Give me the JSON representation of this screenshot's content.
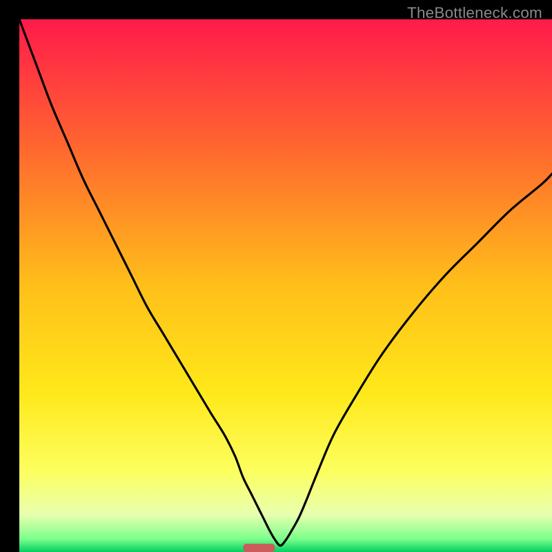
{
  "watermark": "TheBottleneck.com",
  "chart_data": {
    "type": "line",
    "title": "",
    "xlabel": "",
    "ylabel": "",
    "xlim": [
      0,
      100
    ],
    "ylim": [
      0,
      100
    ],
    "grid": false,
    "legend": false,
    "background_gradient_stops": [
      {
        "offset": 0.0,
        "color": "#ff1a4b"
      },
      {
        "offset": 0.25,
        "color": "#ff6a2e"
      },
      {
        "offset": 0.5,
        "color": "#ffbf1a"
      },
      {
        "offset": 0.7,
        "color": "#ffe81a"
      },
      {
        "offset": 0.85,
        "color": "#fcff60"
      },
      {
        "offset": 0.93,
        "color": "#e8ffb0"
      },
      {
        "offset": 0.975,
        "color": "#7dff8c"
      },
      {
        "offset": 1.0,
        "color": "#00d060"
      }
    ],
    "series": [
      {
        "name": "curve",
        "x": [
          0,
          3,
          6,
          9,
          12,
          15,
          18,
          21,
          24,
          27,
          30,
          33,
          36,
          38.5,
          40.5,
          42,
          43.5,
          45,
          46,
          47,
          48,
          49,
          50,
          51,
          52.5,
          54,
          56,
          59,
          63,
          68,
          74,
          80,
          86,
          92,
          98,
          100
        ],
        "y": [
          100,
          92,
          84,
          77,
          70,
          64,
          58,
          52,
          46,
          41,
          36,
          31,
          26,
          22,
          18,
          14,
          11,
          8,
          6,
          4,
          2.3,
          1.2,
          2.2,
          3.8,
          6.5,
          10,
          15,
          22,
          29,
          37,
          45,
          52,
          58,
          64,
          69,
          71
        ]
      }
    ],
    "marker": {
      "name": "bottleneck-marker",
      "x_center": 45,
      "width": 6,
      "color": "#cc5b5b"
    }
  }
}
